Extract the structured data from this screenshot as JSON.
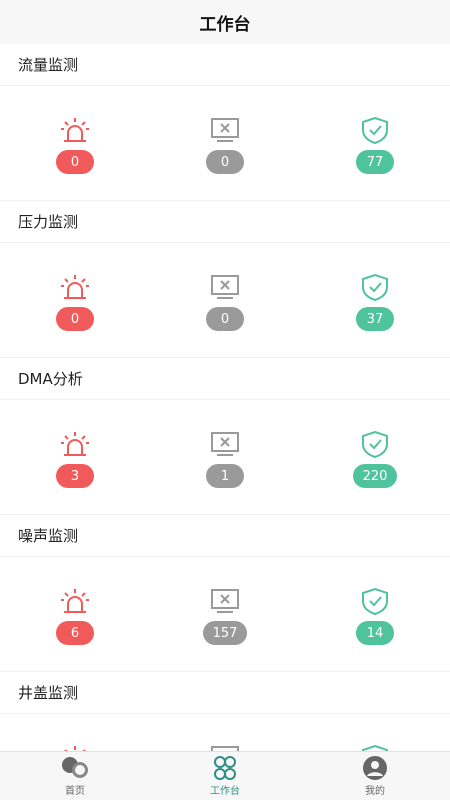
{
  "header": {
    "title": "工作台"
  },
  "colors": {
    "alarm": "#f05a5a",
    "offline": "#9a9a9a",
    "normal": "#4fc39c",
    "active_tab": "#2c8e85"
  },
  "icons": {
    "alarm": "alarm-light-icon",
    "offline": "offline-monitor-icon",
    "normal": "shield-check-icon"
  },
  "sections": [
    {
      "title": "流量监测",
      "alarm": "0",
      "offline": "0",
      "normal": "77"
    },
    {
      "title": "压力监测",
      "alarm": "0",
      "offline": "0",
      "normal": "37"
    },
    {
      "title": "DMA分析",
      "alarm": "3",
      "offline": "1",
      "normal": "220"
    },
    {
      "title": "噪声监测",
      "alarm": "6",
      "offline": "157",
      "normal": "14"
    },
    {
      "title": "井盖监测",
      "alarm": "",
      "offline": "",
      "normal": ""
    }
  ],
  "tabbar": {
    "home": "首页",
    "workbench": "工作台",
    "mine": "我的",
    "active": "workbench"
  }
}
